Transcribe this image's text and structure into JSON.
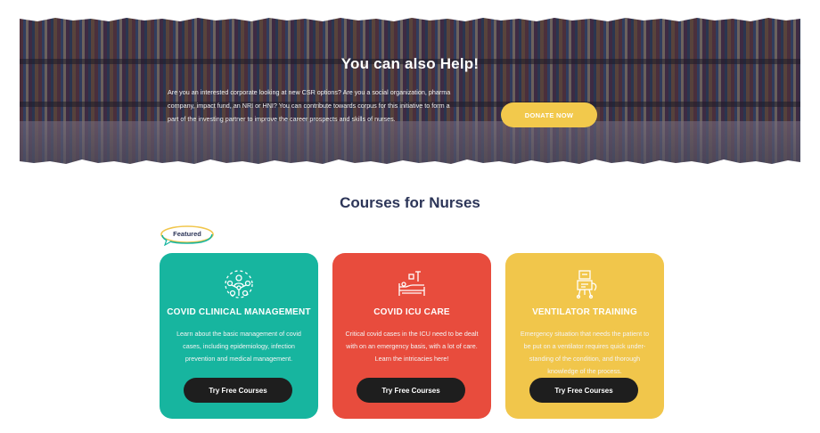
{
  "banner": {
    "title": "You can also Help!",
    "text": "Are you an interested corporate looking at new CSR options? Are you a social organization, pharma company, impact fund, an NRI or HNI? You can contribute towards corpus for this initiative to form a part of the investing partner to improve the career prospects and skills of nurses.",
    "donate_label": "DONATE NOW"
  },
  "courses": {
    "title": "Courses for Nurses",
    "featured_label": "Featured",
    "cards": [
      {
        "icon": "team-network-icon",
        "title": "COVID CLINICAL MANAGEMENT",
        "description": "Learn about the basic management of covid cases, including epidemiology, infection prevention and medical management.",
        "button_label": "Try Free Courses"
      },
      {
        "icon": "icu-bed-icon",
        "title": "COVID ICU CARE",
        "description": "Critical covid cases in the ICU need to be dealt  with on an emergency basis, with a lot of care. Learn the intricacies here!",
        "button_label": "Try Free Courses"
      },
      {
        "icon": "ventilator-icon",
        "title": "VENTILATOR TRAINING",
        "description": "Emergency situation that needs the patient to be put on a ventilator requires quick under-standing  of the condition, and thorough knowledge of the process.",
        "button_label": "Try Free Courses"
      }
    ]
  },
  "colors": {
    "title": "#2c3558",
    "donate": "#f2c94c",
    "card_teal": "#17b59f",
    "card_red": "#e84c3d",
    "card_yellow": "#f1c64b",
    "button": "#1e1e1e"
  }
}
